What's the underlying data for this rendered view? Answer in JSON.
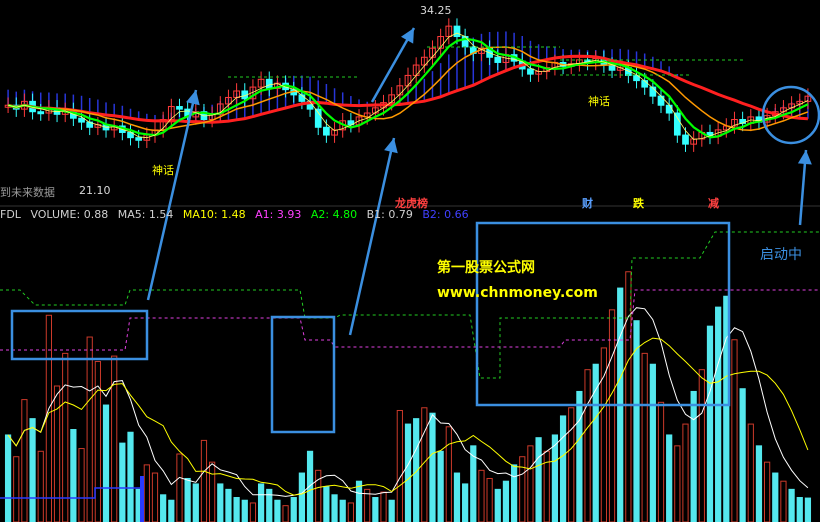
{
  "colors": {
    "background": "#000000",
    "up_candle": "#ff3b3b",
    "down_candle": "#33ffff",
    "ma_red": "#ff2020",
    "ma_green": "#00ff00",
    "ma_orange": "#ff9900",
    "cloud_blue": "#3040ff",
    "vol_red": "#cc3a2a",
    "vol_cyan": "#55e8ee",
    "annotation_blue": "#3b8fe0",
    "watermark_yellow": "#ffff00",
    "magenta_line": "#e040e0",
    "green_dashed": "#22cc22"
  },
  "price_panel": {
    "high_label": "34.25",
    "low_label": "21.10",
    "future_data_label": "到未来数据",
    "signal_labels": [
      "神话",
      "神话"
    ],
    "event_labels": [
      {
        "text": "龙虎榜",
        "color": "#ff4040"
      },
      {
        "text": "财",
        "color": "#5aa0ff"
      },
      {
        "text": "跌",
        "color": "#ffff00"
      },
      {
        "text": "减",
        "color": "#ff4040"
      }
    ]
  },
  "indicator_bar": [
    {
      "text": "FDL",
      "color": "#d0d0d0"
    },
    {
      "text": "VOLUME: 0.88",
      "color": "#d0d0d0"
    },
    {
      "text": "MA5: 1.54",
      "color": "#d0d0d0"
    },
    {
      "text": "MA10: 1.48",
      "color": "#ffff00"
    },
    {
      "text": "A1: 3.93",
      "color": "#ff40ff"
    },
    {
      "text": "A2: 4.80",
      "color": "#00ff00"
    },
    {
      "text": "B1: 0.79",
      "color": "#d0d0d0"
    },
    {
      "text": "B2: 0.66",
      "color": "#4040ff"
    }
  ],
  "watermark": {
    "title": "第一股票公式网",
    "url": "www.chnmoney.com"
  },
  "annotation": {
    "text": "启动中"
  },
  "chart_data": {
    "type": "bar",
    "title": "",
    "xlabel": "",
    "ylabel": "",
    "series": [
      {
        "name": "VOLUME",
        "values": [
          3.2,
          2.4,
          4.5,
          3.8,
          2.6,
          7.6,
          5.0,
          6.2,
          3.4,
          2.7,
          6.8,
          5.9,
          4.3,
          6.1,
          2.9,
          3.3,
          1.2,
          2.1,
          1.8,
          1.0,
          0.8,
          2.5,
          1.6,
          1.4,
          3.0,
          2.2,
          1.4,
          1.2,
          0.9,
          0.8,
          0.7,
          1.4,
          1.2,
          0.8,
          0.6,
          0.9,
          1.8,
          2.6,
          1.9,
          1.3,
          1.0,
          0.8,
          0.7,
          1.5,
          1.2,
          0.9,
          1.1,
          0.8,
          4.1,
          3.6,
          3.8,
          4.2,
          4.0,
          2.6,
          3.5,
          1.8,
          1.4,
          2.8,
          1.9,
          1.6,
          1.2,
          1.5,
          2.1,
          2.4,
          2.8,
          3.1,
          2.6,
          3.2,
          3.9,
          4.2,
          4.8,
          5.6,
          5.8,
          6.4,
          7.8,
          8.6,
          9.2,
          7.4,
          6.2,
          5.8,
          4.4,
          3.2,
          2.8,
          3.6,
          4.8,
          5.6,
          7.2,
          7.9,
          8.3,
          6.7,
          4.9,
          3.6,
          2.8,
          2.2,
          1.8,
          1.5,
          1.2,
          0.9,
          0.88
        ],
        "colors": [
          "c",
          "r",
          "r",
          "c",
          "r",
          "r",
          "r",
          "r",
          "c",
          "r",
          "r",
          "r",
          "c",
          "r",
          "c",
          "c",
          "c",
          "r",
          "r",
          "c",
          "c",
          "r",
          "c",
          "c",
          "r",
          "r",
          "c",
          "c",
          "c",
          "c",
          "r",
          "c",
          "c",
          "c",
          "r",
          "c",
          "c",
          "c",
          "r",
          "c",
          "c",
          "c",
          "r",
          "c",
          "r",
          "c",
          "r",
          "c",
          "r",
          "c",
          "c",
          "r",
          "c",
          "c",
          "r",
          "c",
          "c",
          "c",
          "r",
          "r",
          "c",
          "c",
          "c",
          "r",
          "r",
          "c",
          "r",
          "c",
          "c",
          "r",
          "c",
          "r",
          "c",
          "r",
          "r",
          "c",
          "r",
          "c",
          "r",
          "c",
          "r",
          "c",
          "r",
          "r",
          "c",
          "r",
          "c",
          "c",
          "c",
          "r",
          "c",
          "r",
          "c",
          "r",
          "c",
          "r",
          "c",
          "c",
          "c"
        ]
      },
      {
        "name": "MA5",
        "values": []
      },
      {
        "name": "MA10",
        "values": []
      }
    ],
    "price": {
      "close": [
        27.5,
        27.2,
        27.8,
        27.0,
        26.9,
        27.3,
        26.8,
        27.1,
        26.5,
        26.2,
        25.8,
        26.0,
        25.6,
        25.9,
        25.4,
        25.0,
        24.8,
        25.2,
        25.6,
        26.4,
        27.4,
        27.2,
        26.6,
        27.0,
        26.4,
        26.8,
        27.6,
        28.1,
        28.6,
        28.0,
        28.9,
        29.5,
        28.8,
        29.2,
        28.7,
        28.3,
        27.8,
        27.2,
        25.8,
        25.2,
        25.6,
        26.3,
        26.0,
        26.6,
        26.9,
        27.3,
        27.7,
        28.3,
        29.0,
        29.8,
        30.6,
        31.2,
        31.9,
        32.8,
        33.6,
        32.8,
        32.0,
        31.5,
        31.9,
        31.2,
        30.8,
        31.4,
        30.9,
        30.3,
        29.9,
        30.1,
        30.4,
        30.8,
        30.5,
        30.7,
        31.0,
        30.8,
        31.1,
        30.6,
        30.2,
        30.4,
        29.8,
        29.4,
        28.9,
        28.2,
        27.5,
        26.9,
        25.2,
        24.5,
        24.9,
        25.4,
        25.1,
        25.6,
        25.9,
        26.4,
        26.1,
        26.6,
        26.2,
        26.7,
        27.0,
        27.3,
        27.6,
        27.8,
        28.2
      ],
      "ylim": [
        20.5,
        35.0
      ]
    }
  }
}
